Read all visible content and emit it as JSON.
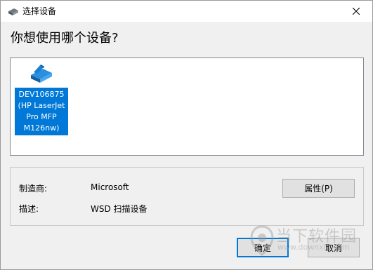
{
  "window": {
    "title": "选择设备",
    "close_glyph": "✕",
    "icon": "scanner-icon"
  },
  "heading": "你想使用哪个设备?",
  "devices": [
    {
      "label": "DEV106875\n(HP LaserJet\nPro MFP\nM126nw)",
      "icon": "scanner-icon",
      "selected": true
    }
  ],
  "info": {
    "manufacturer_label": "制造商:",
    "manufacturer_value": "Microsoft",
    "description_label": "描述:",
    "description_value": "WSD 扫描设备",
    "properties_button": "属性(P)"
  },
  "buttons": {
    "ok": "确定",
    "cancel": "取消"
  },
  "watermark": {
    "main": "当下软件园",
    "sub": "www.downxia.com"
  },
  "colors": {
    "selection": "#0078d7",
    "window_bg": "#f0f0f0",
    "panel_bg": "#ffffff"
  }
}
